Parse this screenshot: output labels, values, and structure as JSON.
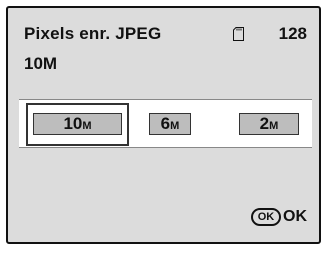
{
  "header": {
    "title": "Pixels enr. JPEG",
    "card_icon": "sd-card-icon",
    "remaining_shots": "128",
    "current_value": "10M"
  },
  "options": [
    {
      "number": "10",
      "unit": "M",
      "selected": true
    },
    {
      "number": "6",
      "unit": "M",
      "selected": false
    },
    {
      "number": "2",
      "unit": "M",
      "selected": false
    }
  ],
  "footer": {
    "ok_icon": "OK",
    "ok_label": "OK"
  },
  "colors": {
    "screen_bg": "#dcdcdc",
    "option_bg": "#bdbdbd",
    "text": "#111111"
  }
}
